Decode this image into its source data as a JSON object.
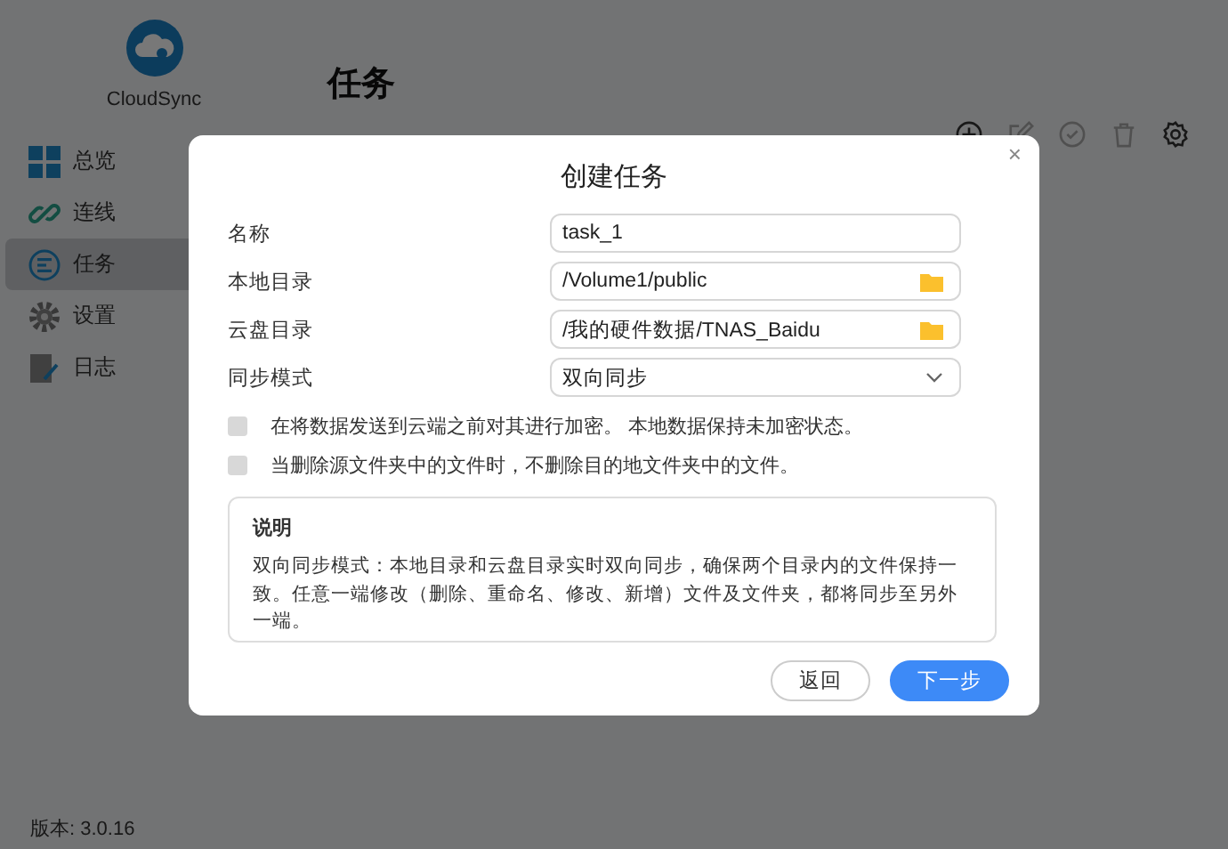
{
  "app": {
    "name": "CloudSync",
    "version": "版本: 3.0.16"
  },
  "sidebar": {
    "items": [
      {
        "label": "总览",
        "selected": false
      },
      {
        "label": "连线",
        "selected": false
      },
      {
        "label": "任务",
        "selected": true
      },
      {
        "label": "设置",
        "selected": false
      },
      {
        "label": "日志",
        "selected": false
      }
    ]
  },
  "page": {
    "title": "任务"
  },
  "toolbar": [
    {
      "disabled": false
    },
    {
      "disabled": true
    },
    {
      "disabled": true
    },
    {
      "disabled": true
    },
    {
      "disabled": false
    }
  ],
  "dialog": {
    "title": "创建任务",
    "close": "×",
    "fields": [
      {
        "label": "名称",
        "kind": "text",
        "value": "task_1"
      },
      {
        "label": "本地目录",
        "kind": "folder",
        "value": "/Volume1/public"
      },
      {
        "label": "云盘目录",
        "kind": "folder",
        "value": "/我的硬件数据/TNAS_Baidu"
      },
      {
        "label": "同步模式",
        "kind": "select",
        "value": "双向同步"
      }
    ],
    "options": [
      {
        "label": "在将数据发送到云端之前对其进行加密。 本地数据保持未加密状态。",
        "checked": false
      },
      {
        "label": "当删除源文件夹中的文件时，不删除目的地文件夹中的文件。",
        "checked": false
      }
    ],
    "note": {
      "title": "说明",
      "text": "双向同步模式：本地目录和云盘目录实时双向同步，确保两个目录内的文件保持一致。任意一端修改（删除、重命名、修改、新增）文件及文件夹，都将同步至另外一端。"
    },
    "buttons": [
      {
        "label": "返回",
        "kind": "secondary"
      },
      {
        "label": "下一步",
        "kind": "primary"
      }
    ]
  }
}
